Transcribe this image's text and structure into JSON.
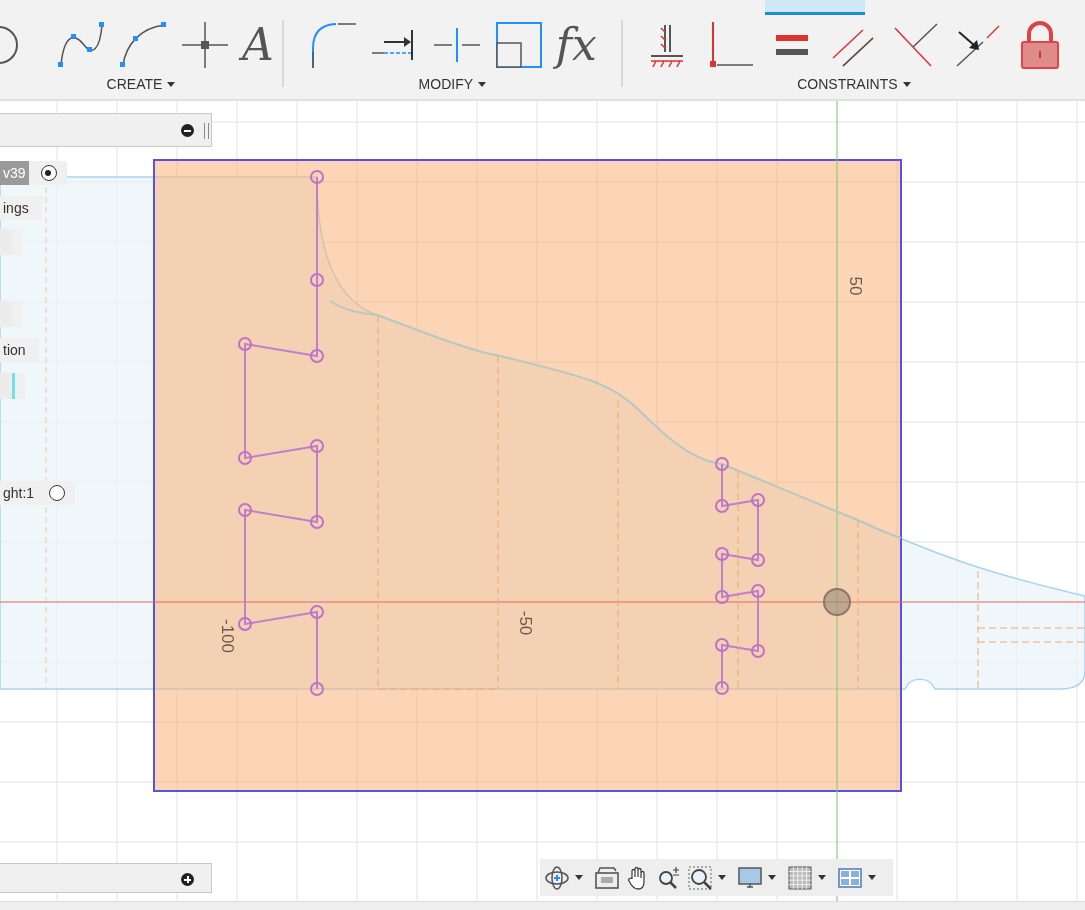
{
  "toolbar": {
    "groups": [
      {
        "label": "CREATE",
        "tools": [
          {
            "kind": "circle"
          },
          {
            "kind": "spline"
          },
          {
            "kind": "arc"
          },
          {
            "kind": "point"
          },
          {
            "kind": "glyph",
            "glyph": "A"
          }
        ]
      },
      {
        "label": "MODIFY",
        "tools": [
          {
            "kind": "fillet"
          },
          {
            "kind": "extend"
          },
          {
            "kind": "break"
          },
          {
            "kind": "offset"
          },
          {
            "kind": "glyph",
            "glyph": "fx"
          }
        ]
      },
      {
        "label": "CONSTRAINTS",
        "tools": [
          {
            "kind": "fix"
          },
          {
            "kind": "coincident"
          },
          {
            "kind": "equal"
          },
          {
            "kind": "parallel"
          },
          {
            "kind": "perpendicular"
          },
          {
            "kind": "tangent"
          },
          {
            "kind": "lock"
          }
        ]
      }
    ]
  },
  "browser": {
    "items": [
      {
        "kind": "radio",
        "label": "v39",
        "selected": true
      },
      {
        "kind": "row",
        "label": "ings"
      },
      {
        "kind": "stub"
      },
      {
        "kind": "stub"
      },
      {
        "kind": "row",
        "label": "tion"
      },
      {
        "kind": "stub"
      },
      {
        "kind": "radio",
        "label": "ght:1",
        "selected": false
      }
    ]
  },
  "canvas": {
    "axis_labels": [
      {
        "text": "-100"
      },
      {
        "text": "-50"
      },
      {
        "text": "50"
      }
    ]
  },
  "navigation_bar": {
    "tools": [
      {
        "kind": "orbit",
        "menu": true
      },
      {
        "kind": "look",
        "menu": false
      },
      {
        "kind": "pan",
        "menu": false
      },
      {
        "kind": "zoom",
        "menu": false
      },
      {
        "kind": "fit",
        "menu": true
      },
      {
        "kind": "display",
        "menu": true
      },
      {
        "kind": "grid",
        "menu": true
      },
      {
        "kind": "viewports",
        "menu": true
      }
    ]
  }
}
